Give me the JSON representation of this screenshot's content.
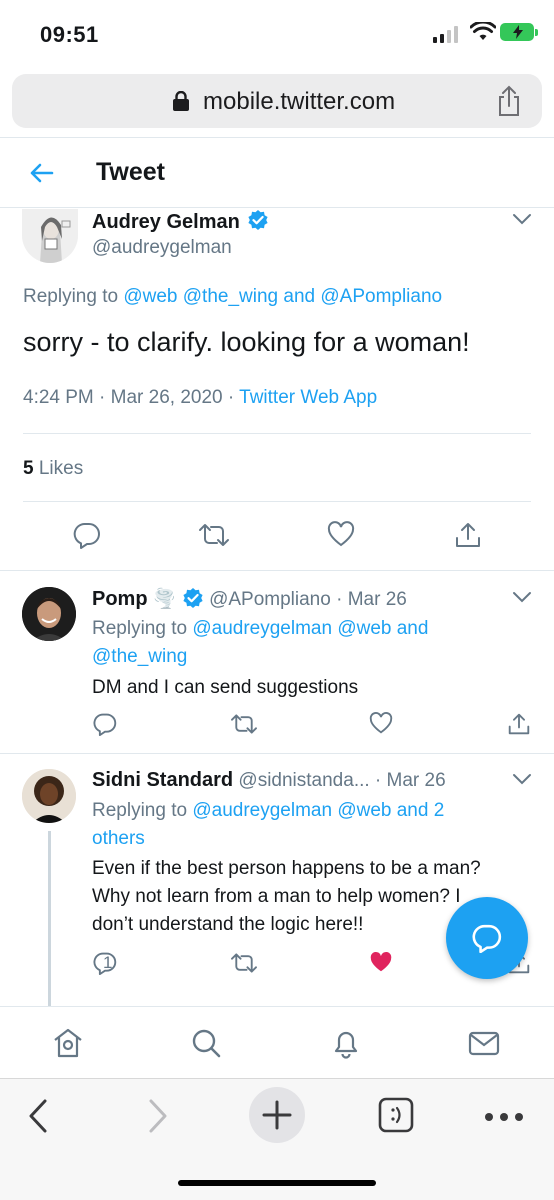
{
  "status_bar": {
    "time": "09:51"
  },
  "browser": {
    "url": "mobile.twitter.com"
  },
  "header": {
    "title": "Tweet"
  },
  "main_tweet": {
    "name": "Audrey Gelman",
    "handle": "@audreygelman",
    "replying_prefix": "Replying to",
    "replying_to": "@web @the_wing and @APompliano",
    "text": "sorry - to clarify. looking for a woman!",
    "time": "4:24 PM · Mar 26, 2020 ·",
    "source": "Twitter Web App",
    "likes_count": "5",
    "likes_label": "Likes"
  },
  "replies": [
    {
      "name": "Pomp",
      "emoji": "🌪️",
      "handle_date": "@APompliano · Mar 26",
      "replying_prefix": "Replying to",
      "replying_line1": "@audreygelman @web and",
      "replying_line2": "@the_wing",
      "text": "DM and I can send suggestions"
    },
    {
      "name": "Sidni Standard",
      "handle_date": "@sidnistanda... · Mar 26",
      "replying_prefix": "Replying to",
      "replying_line1": "@audreygelman @web and 2",
      "replying_line2": "others",
      "text_lines": [
        "Even if the best person happens to be a man?",
        "Why not learn from a man to help women? I",
        "don’t understand the logic here!!"
      ],
      "reply_count": "1",
      "liked": true
    }
  ],
  "colors": {
    "accent": "#1da1f2",
    "like": "#e0245e",
    "secondary_text": "#657786",
    "verified": "#1da1f2"
  },
  "icons": {
    "tabbar": [
      "home-icon",
      "search-icon",
      "notifications-icon",
      "messages-icon"
    ],
    "safari": [
      "back-icon",
      "forward-icon",
      "new-tab-icon",
      "tabs-icon",
      "more-icon"
    ]
  }
}
